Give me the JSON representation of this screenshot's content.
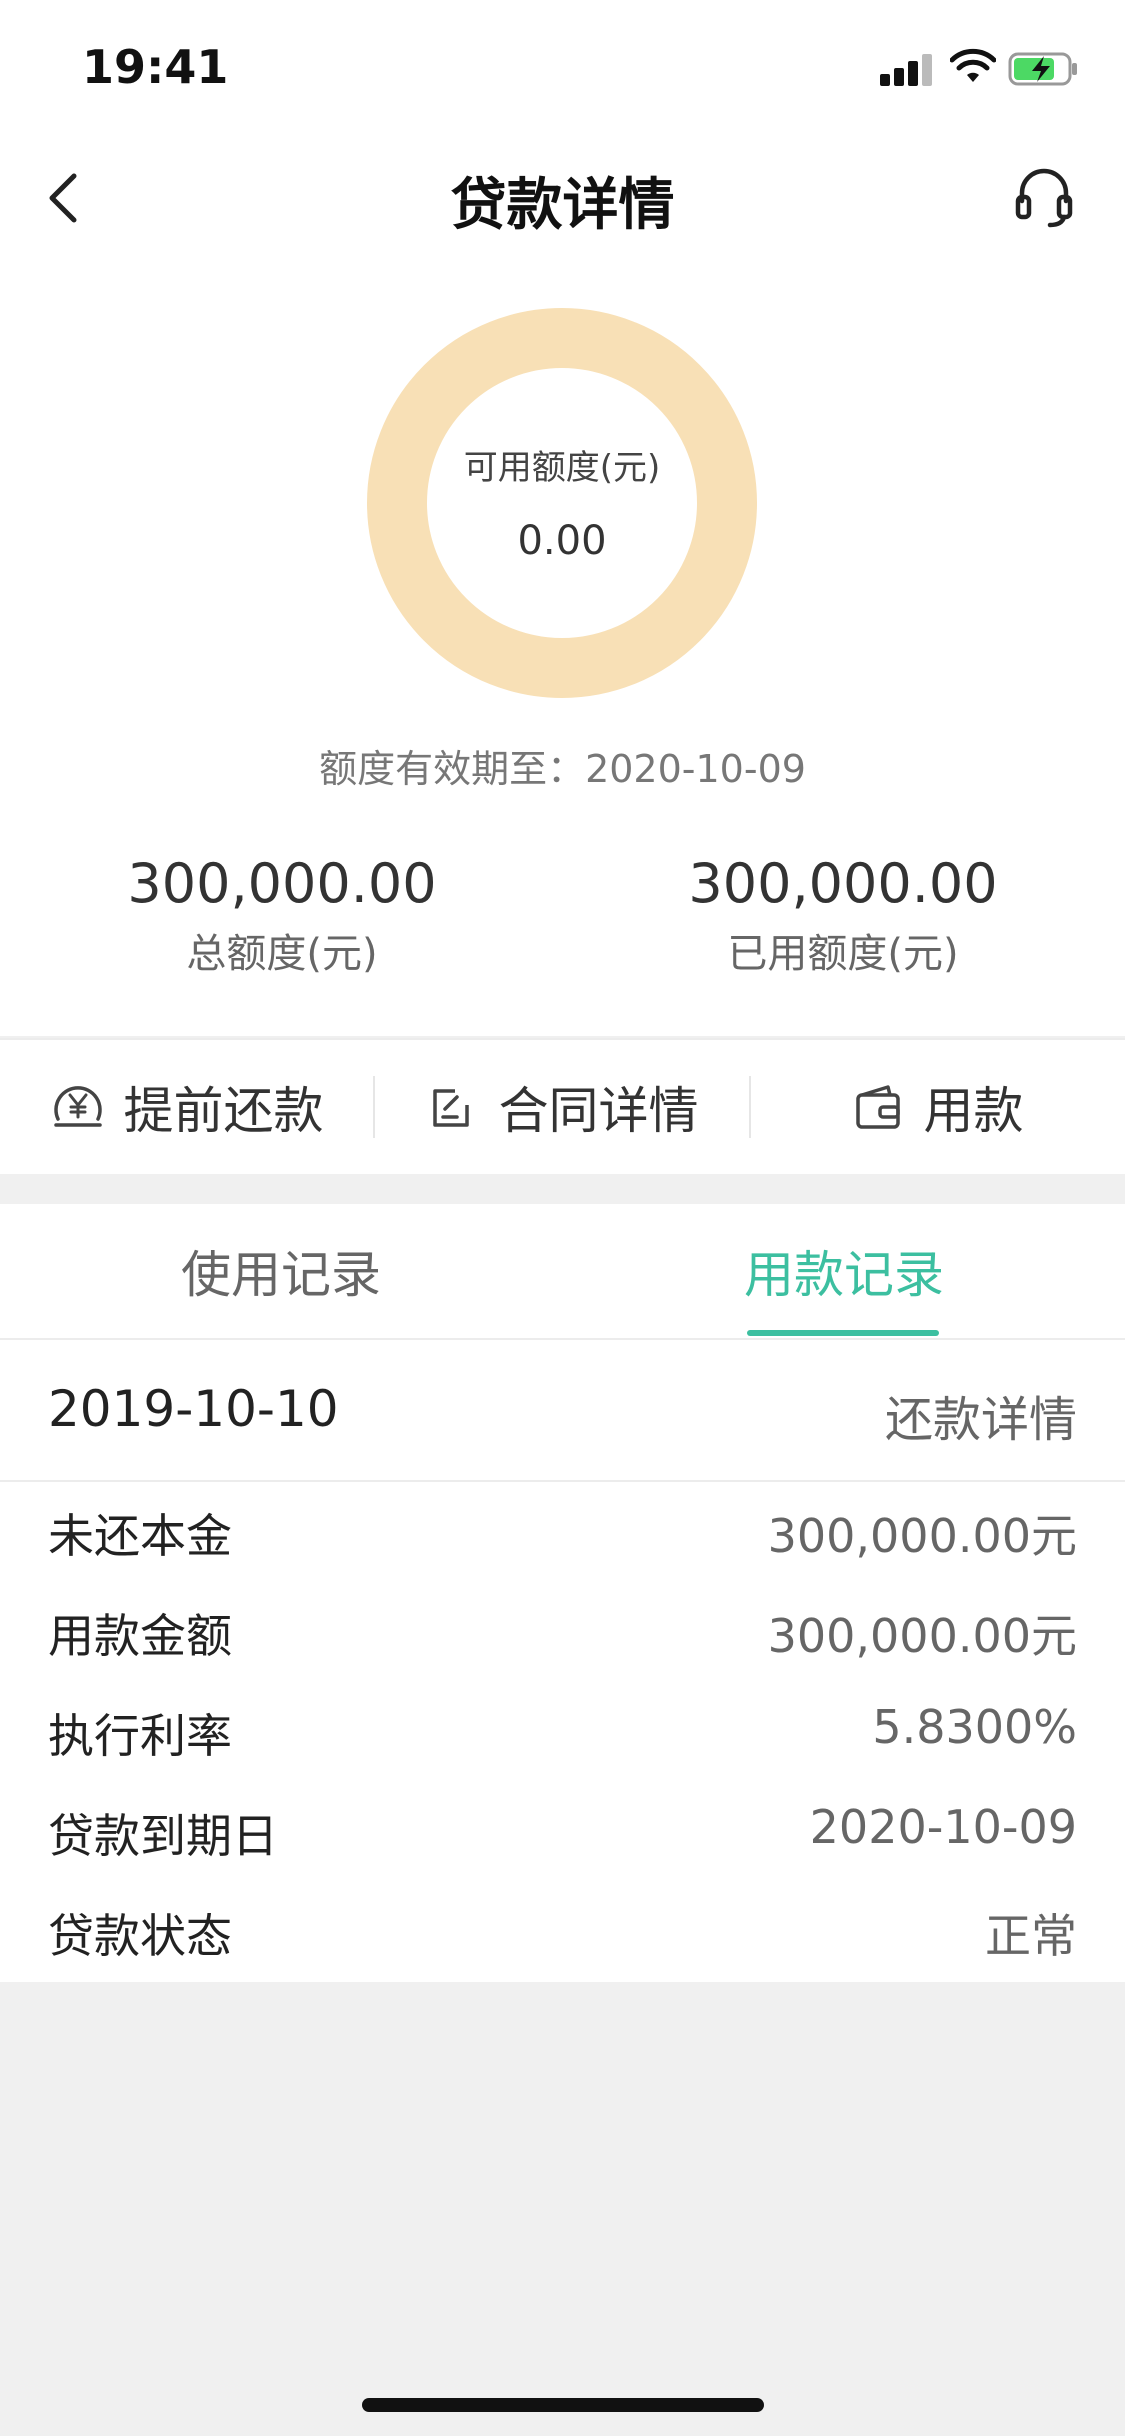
{
  "status_bar": {
    "time": "19:41"
  },
  "header": {
    "title": "贷款详情"
  },
  "summary": {
    "available_label": "可用额度(元)",
    "available_value": "0.00",
    "validity": "额度有效期至：2020-10-09",
    "total_value": "300,000.00",
    "total_label": "总额度(元)",
    "used_value": "300,000.00",
    "used_label": "已用额度(元)",
    "available_fraction": 0,
    "ring_color": "#f8e0b6"
  },
  "actions": [
    {
      "label": "提前还款",
      "icon": "yuan-coin-icon"
    },
    {
      "label": "合同详情",
      "icon": "edit-document-icon"
    },
    {
      "label": "用款",
      "icon": "wallet-icon"
    }
  ],
  "tabs": [
    {
      "label": "使用记录",
      "active": false
    },
    {
      "label": "用款记录",
      "active": true
    }
  ],
  "record": {
    "date": "2019-10-10",
    "detail_link": "还款详情",
    "rows": [
      {
        "label": "未还本金",
        "value": "300,000.00元"
      },
      {
        "label": "用款金额",
        "value": "300,000.00元"
      },
      {
        "label": "执行利率",
        "value": "5.8300%"
      },
      {
        "label": "贷款到期日",
        "value": "2020-10-09"
      },
      {
        "label": "贷款状态",
        "value": "正常"
      }
    ]
  },
  "colors": {
    "accent": "#3cbfa0",
    "ring": "#f8e0b6",
    "battery_fill": "#4cd964"
  }
}
